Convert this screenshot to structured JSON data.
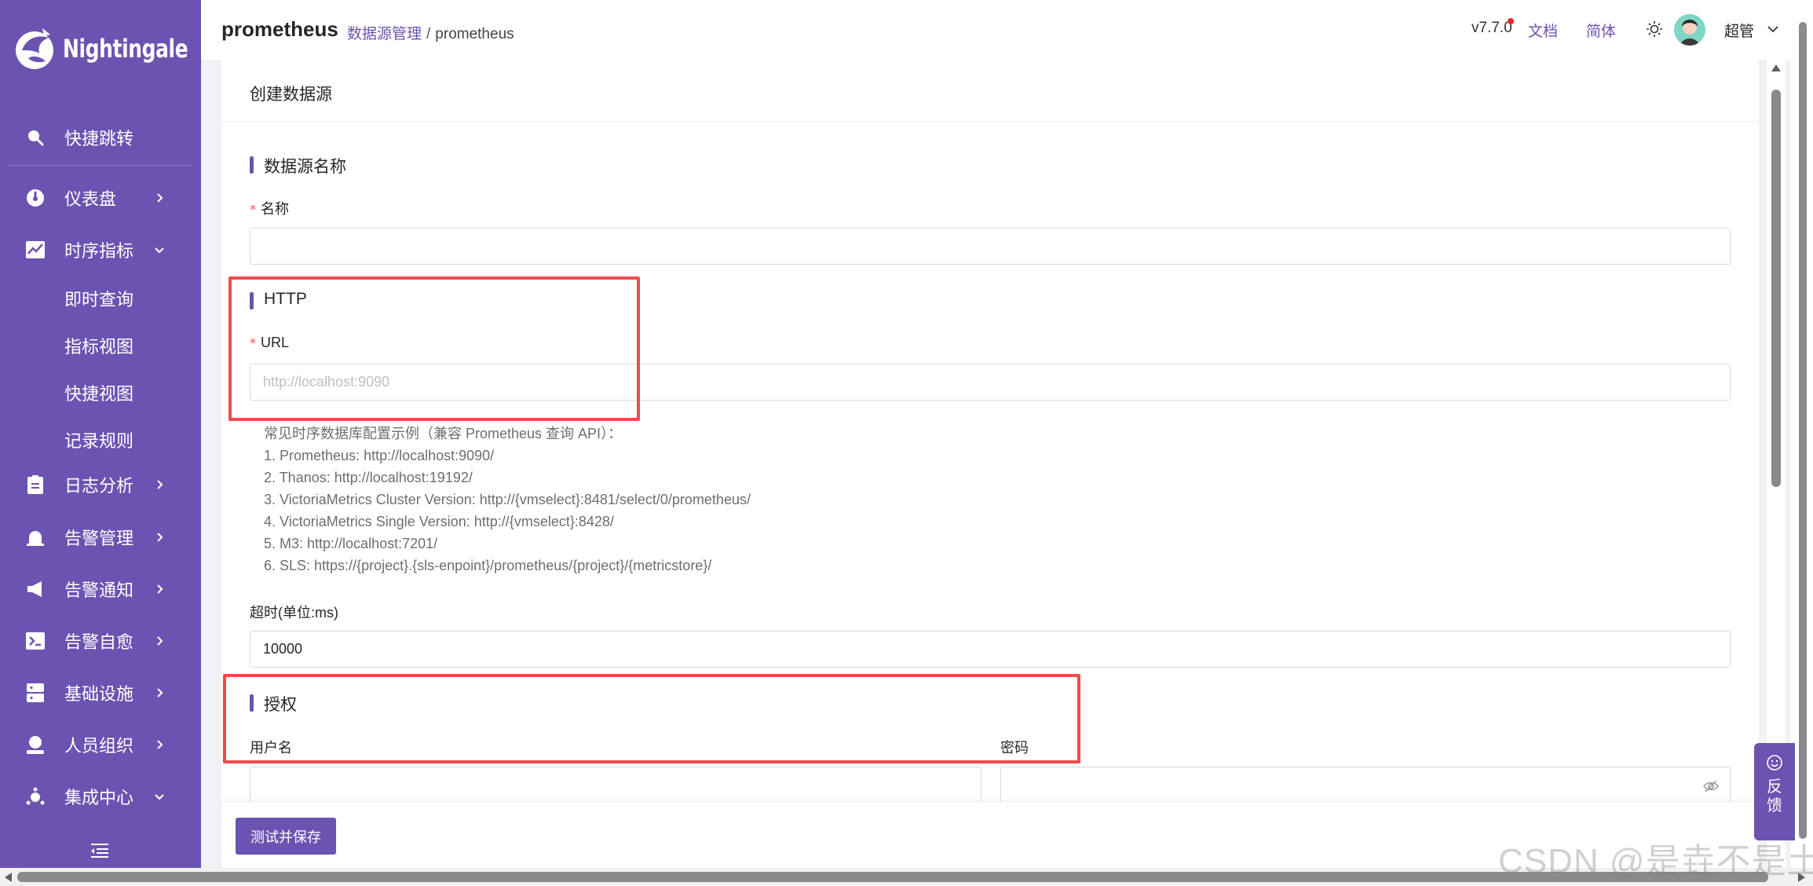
{
  "app": {
    "logo_text": "Nightingale"
  },
  "sidebar": {
    "quick_jump": "快捷跳转",
    "items": [
      {
        "label": "仪表盘",
        "icon": "dashboard-icon"
      },
      {
        "label": "时序指标",
        "icon": "line-chart-icon",
        "expanded": true,
        "children": [
          "即时查询",
          "指标视图",
          "快捷视图",
          "记录规则"
        ]
      },
      {
        "label": "日志分析",
        "icon": "log-icon"
      },
      {
        "label": "告警管理",
        "icon": "alarm-icon"
      },
      {
        "label": "告警通知",
        "icon": "megaphone-icon"
      },
      {
        "label": "告警自愈",
        "icon": "terminal-icon"
      },
      {
        "label": "基础设施",
        "icon": "server-icon"
      },
      {
        "label": "人员组织",
        "icon": "user-icon"
      },
      {
        "label": "集成中心",
        "icon": "integration-icon",
        "expanded": true
      }
    ]
  },
  "header": {
    "title": "prometheus",
    "breadcrumb_link": "数据源管理",
    "breadcrumb_sep": "/",
    "breadcrumb_current": "prometheus",
    "version": "v7.7.0",
    "docs": "文档",
    "language": "简体",
    "user_name": "超管"
  },
  "form": {
    "panel_title": "创建数据源",
    "section_name": "数据源名称",
    "name_label": "名称",
    "name_value": "",
    "section_http": "HTTP",
    "url_label": "URL",
    "url_placeholder": "http://localhost:9090",
    "help_lines": [
      "常见时序数据库配置示例（兼容 Prometheus 查询 API）：",
      "1. Prometheus: http://localhost:9090/",
      "2. Thanos: http://localhost:19192/",
      "3. VictoriaMetrics Cluster Version: http://{vmselect}:8481/select/0/prometheus/",
      "4. VictoriaMetrics Single Version: http://{vmselect}:8428/",
      "5. M3: http://localhost:7201/",
      "6. SLS: https://{project}.{sls-enpoint}/prometheus/{project}/{metricstore}/"
    ],
    "timeout_label": "超时(单位:ms)",
    "timeout_value": "10000",
    "section_auth": "授权",
    "username_label": "用户名",
    "password_label": "密码",
    "save_button": "测试并保存"
  },
  "feedback": {
    "label": "反馈"
  },
  "watermark": "CSDN @是垚不是土",
  "colors": {
    "brand": "#6c53b1",
    "annotation": "#ef4b4c",
    "required": "#ff4d4f"
  }
}
